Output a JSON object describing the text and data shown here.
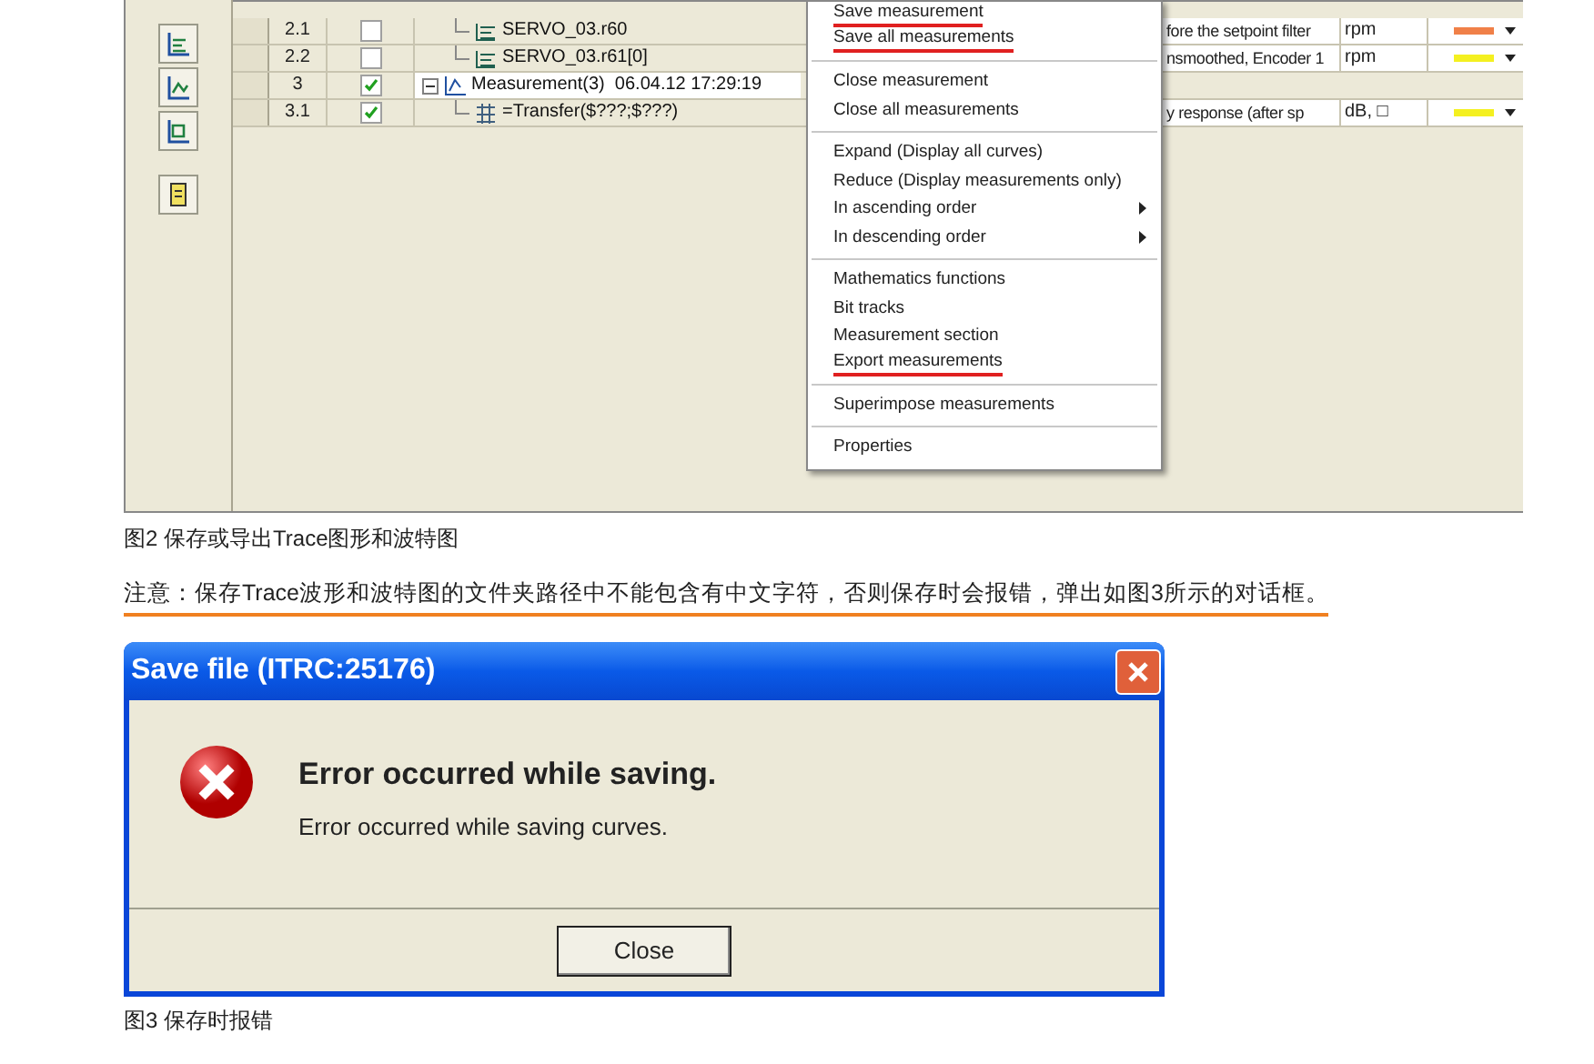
{
  "figure2": {
    "rows": [
      {
        "kind": "curve",
        "number": "2.1",
        "checked": false,
        "label": "SERVO_03.r60",
        "description": "fore the setpoint filter",
        "unit": "rpm",
        "color": "#f08048"
      },
      {
        "kind": "curve",
        "number": "2.2",
        "checked": false,
        "label": "SERVO_03.r61[0]",
        "description": "nsmoothed, Encoder 1",
        "unit": "rpm",
        "color": "#f4f020"
      },
      {
        "kind": "measurement",
        "number": "3",
        "checked": true,
        "label": "Measurement(3)  06.04.12 17:29:19",
        "expanded": true,
        "children": [
          {
            "kind": "transfer",
            "number": "3.1",
            "checked": true,
            "label": "=Transfer($???;$???)",
            "description": "y response (after sp",
            "unit": "dB, □",
            "color": "#f4f020"
          }
        ]
      }
    ],
    "context_menu": {
      "groups": [
        [
          {
            "label": "Save measurement",
            "underlined": true
          },
          {
            "label": "Save all measurements",
            "underlined": true
          }
        ],
        [
          {
            "label": "Close measurement",
            "underlined": false
          },
          {
            "label": "Close all measurements",
            "underlined": false
          }
        ],
        [
          {
            "label": "Expand (Display all curves)",
            "underlined": false
          },
          {
            "label": "Reduce (Display measurements only)",
            "underlined": false
          },
          {
            "label": "In ascending order",
            "underlined": false,
            "submenu": true
          },
          {
            "label": "In descending order",
            "underlined": false,
            "submenu": true
          }
        ],
        [
          {
            "label": "Mathematics functions",
            "underlined": false
          },
          {
            "label": "Bit tracks",
            "underlined": false
          },
          {
            "label": "Measurement section",
            "underlined": false
          },
          {
            "label": "Export measurements",
            "underlined": true
          }
        ],
        [
          {
            "label": "Superimpose measurements",
            "underlined": false
          }
        ],
        [
          {
            "label": "Properties",
            "underlined": false
          }
        ]
      ]
    },
    "caption": "图2 保存或导出Trace图形和波特图"
  },
  "note": "注意：保存Trace波形和波特图的文件夹路径中不能包含有中文字符，否则保存时会报错，弹出如图3所示的对话框。",
  "figure3": {
    "dialog": {
      "title": "Save file (ITRC:25176)",
      "heading": "Error occurred while saving.",
      "message": "Error occurred while saving curves.",
      "button": "Close"
    },
    "caption": "图3 保存时报错"
  }
}
